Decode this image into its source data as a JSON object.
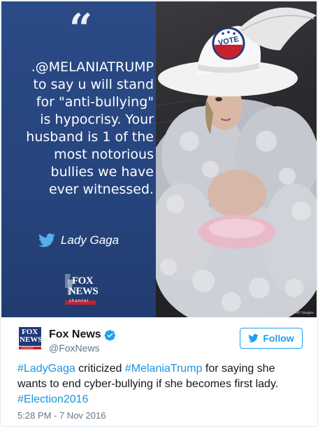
{
  "media": {
    "quote_mark": "“",
    "quote_lines": [
      ".@MELANIATRUMP",
      "to say u will stand",
      "for \"anti-bullying\"",
      "is hypocrisy. Your",
      "husband is 1 of the",
      "most notorious",
      "bullies we have",
      "ever witnessed."
    ],
    "attribution": "Lady Gaga",
    "hat_badge_text": "VOTE",
    "photo_credit": "Rex Features via AP Images",
    "logo_text": [
      "FOX",
      "NEWS",
      "channel"
    ]
  },
  "author": {
    "display_name": "Fox News",
    "handle": "@FoxNews",
    "verified": true,
    "avatar_text": [
      "FOX",
      "NEWS",
      "channel"
    ]
  },
  "follow_button": {
    "label": "Follow",
    "icon": "bird-icon"
  },
  "tweet": {
    "segments": [
      {
        "text": "#LadyGaga",
        "hashtag": true
      },
      {
        "text": " criticized ",
        "hashtag": false
      },
      {
        "text": "#MelaniaTrump",
        "hashtag": true
      },
      {
        "text": " for saying she wants to end cyber-bullying if she becomes first lady. ",
        "hashtag": false
      },
      {
        "text": "#Election2016",
        "hashtag": true
      }
    ]
  },
  "timestamp": "5:28 PM - 7 Nov 2016",
  "colors": {
    "accent": "#1da1f2",
    "hashtag": "#1b95e0",
    "quote_panel": "#26447d",
    "text": "#14171a",
    "muted": "#657786"
  }
}
